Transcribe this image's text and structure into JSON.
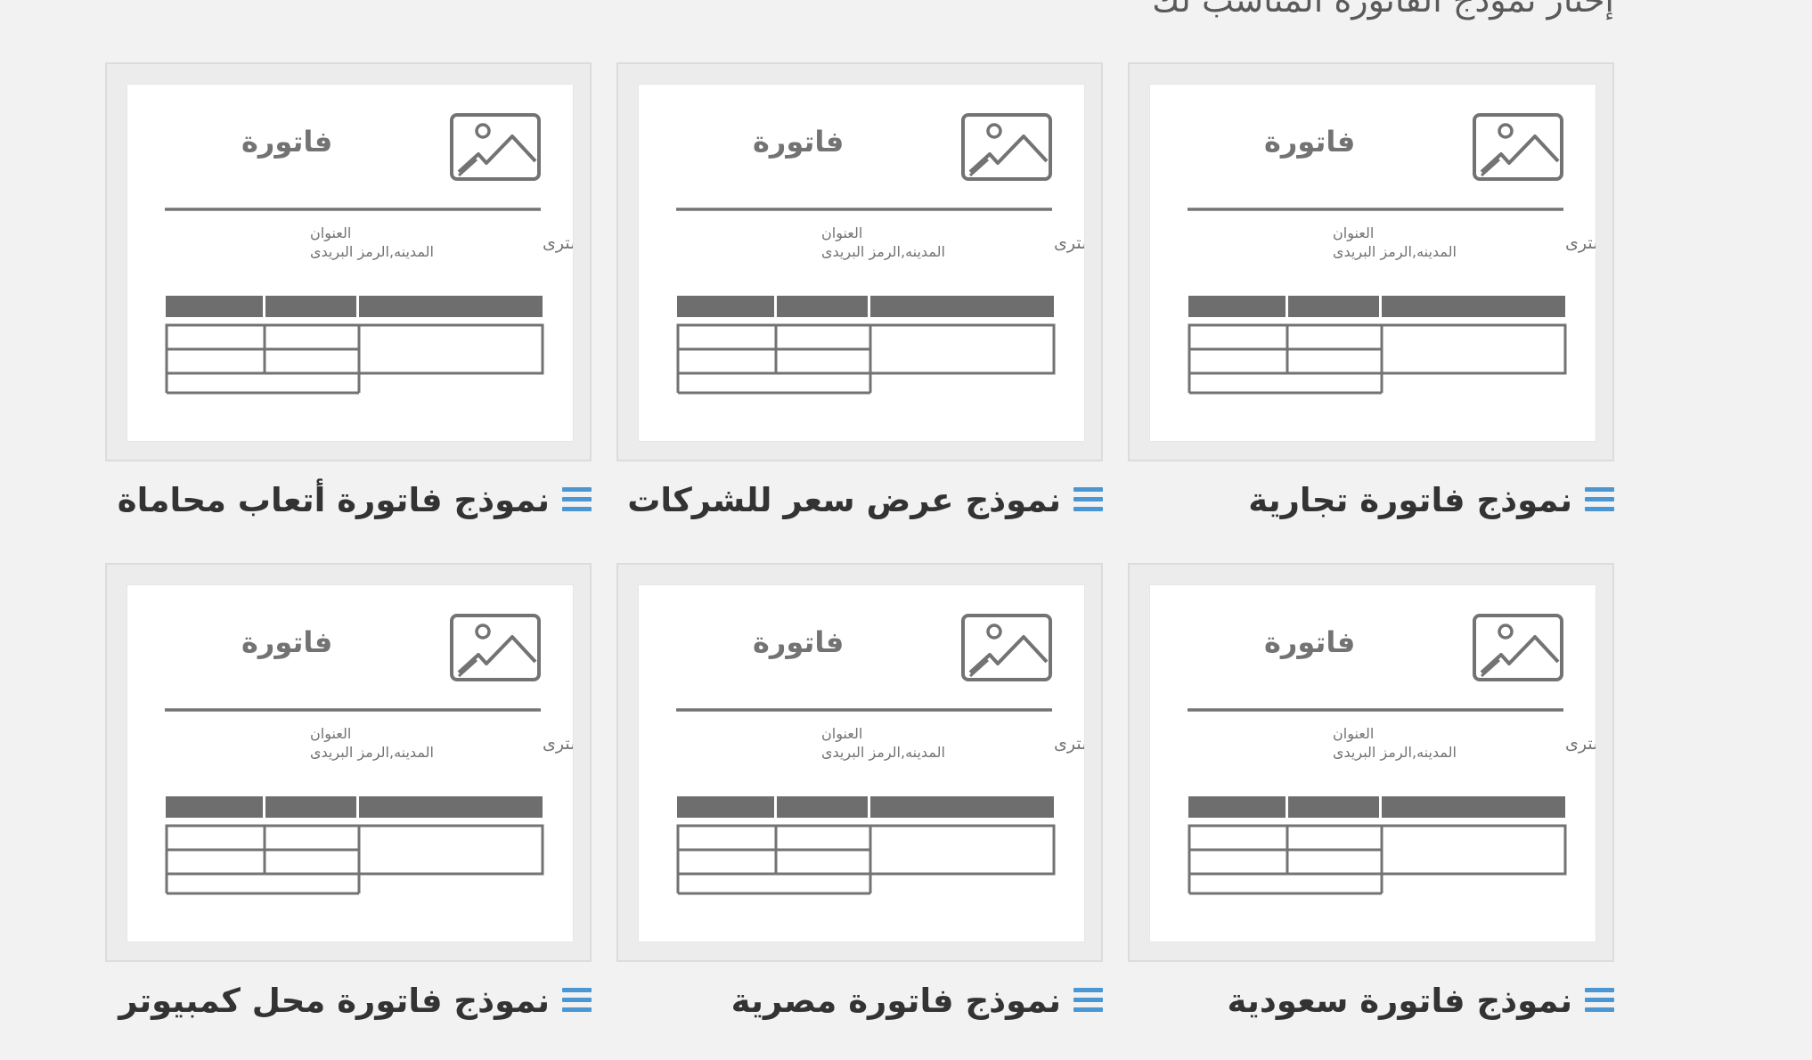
{
  "page": {
    "heading": "إختار نموذج الفاتورة المناسب لك"
  },
  "preview": {
    "title": "فاتورة",
    "buyer": "المشترى",
    "address": "العنوان",
    "city_zip": "المدينه,الرمز البريدى"
  },
  "templates": [
    {
      "title": "نموذج فاتورة تجارية",
      "icon": "menu-lines-icon"
    },
    {
      "title": "نموذج عرض سعر للشركات",
      "icon": "menu-lines-icon"
    },
    {
      "title": "نموذج فاتورة أتعاب محاماة",
      "icon": "menu-lines-icon"
    },
    {
      "title": "نموذج فاتورة سعودية",
      "icon": "menu-lines-icon"
    },
    {
      "title": "نموذج فاتورة مصرية",
      "icon": "menu-lines-icon"
    },
    {
      "title": "نموذج فاتورة محل كمبيوتر",
      "icon": "menu-lines-icon"
    }
  ],
  "colors": {
    "accent": "#4a97d4",
    "caption_text": "#333333",
    "preview_gray": "#6e6e6e",
    "background": "#f2f2f2"
  }
}
